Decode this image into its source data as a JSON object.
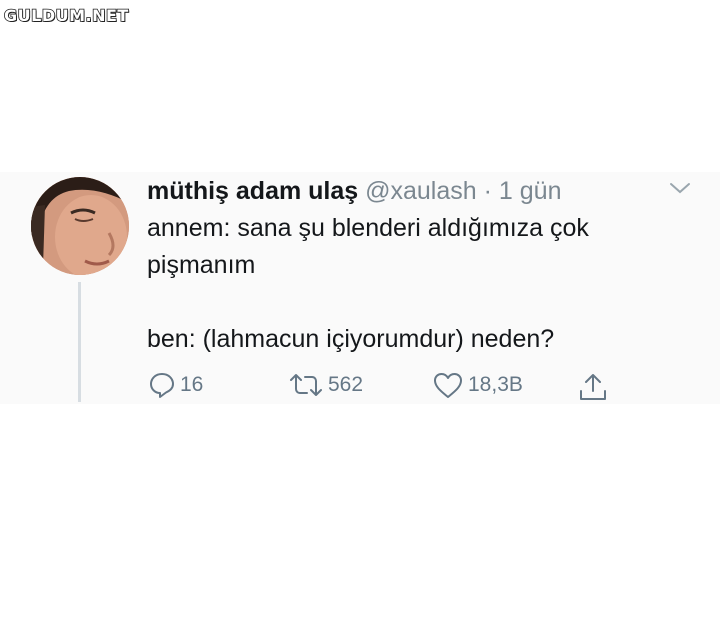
{
  "watermark": {
    "text": "GULDUM.NET"
  },
  "tweet": {
    "display_name": "müthiş adam ulaş",
    "handle": "@xaulash",
    "separator": "·",
    "time": "1 gün",
    "text": "annem: sana şu blenderi aldığımıza çok\npişmanım\n\nben: (lahmacun içiyorumdur) neden?",
    "avatar_icon": "profile-photo"
  },
  "actions": {
    "reply": {
      "icon": "reply-icon",
      "count": "16"
    },
    "retweet": {
      "icon": "retweet-icon",
      "count": "562"
    },
    "like": {
      "icon": "heart-icon",
      "count": "18,3B"
    },
    "share": {
      "icon": "share-icon"
    }
  },
  "colors": {
    "text": "#14171a",
    "muted": "#657786",
    "band": "#fafafa",
    "thread_line": "#d7dde2"
  }
}
